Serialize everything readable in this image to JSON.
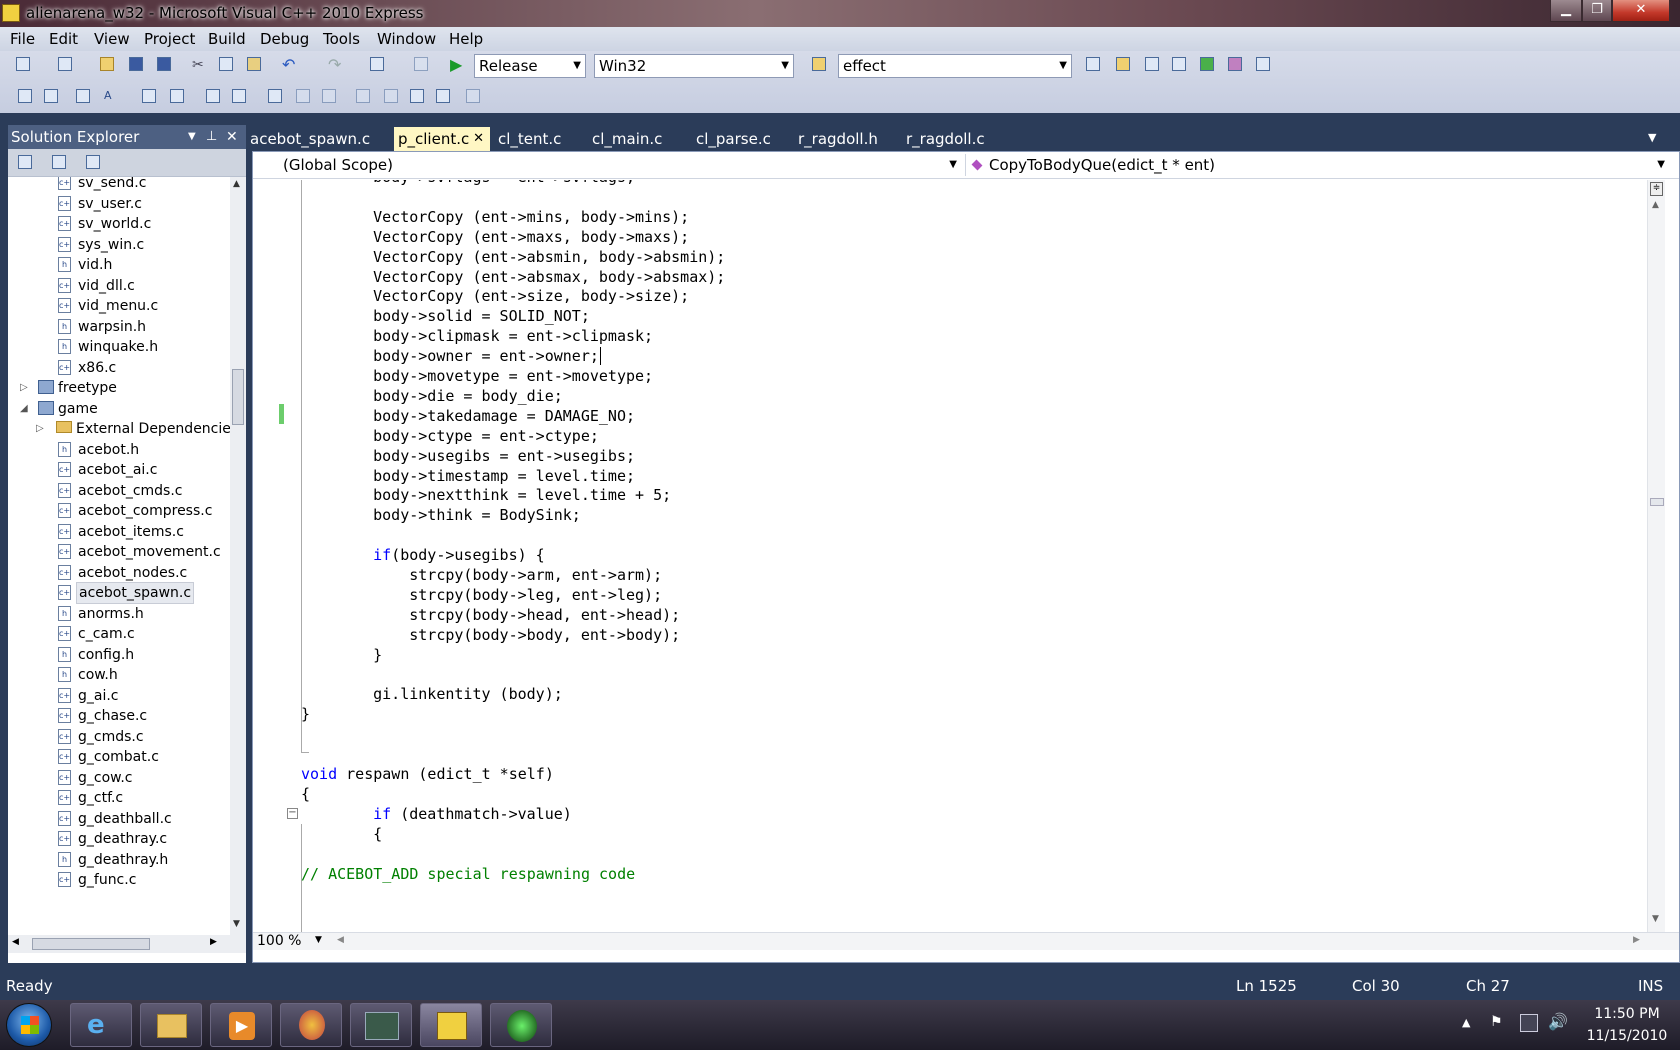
{
  "window": {
    "title": "alienarena_w32 - Microsoft Visual C++ 2010 Express"
  },
  "menu": [
    "File",
    "Edit",
    "View",
    "Project",
    "Build",
    "Debug",
    "Tools",
    "Window",
    "Help"
  ],
  "toolbar": {
    "config": "Release",
    "platform": "Win32",
    "find": "effect"
  },
  "solution_explorer": {
    "title": "Solution Explorer",
    "items": [
      {
        "label": "sv_send.c",
        "type": "c"
      },
      {
        "label": "sv_user.c",
        "type": "c"
      },
      {
        "label": "sv_world.c",
        "type": "c"
      },
      {
        "label": "sys_win.c",
        "type": "c"
      },
      {
        "label": "vid.h",
        "type": "h"
      },
      {
        "label": "vid_dll.c",
        "type": "c"
      },
      {
        "label": "vid_menu.c",
        "type": "c"
      },
      {
        "label": "warpsin.h",
        "type": "h"
      },
      {
        "label": "winquake.h",
        "type": "h"
      },
      {
        "label": "x86.c",
        "type": "c"
      },
      {
        "label": "freetype",
        "type": "project"
      },
      {
        "label": "game",
        "type": "project"
      },
      {
        "label": "External Dependencie",
        "type": "folder"
      },
      {
        "label": "acebot.h",
        "type": "h"
      },
      {
        "label": "acebot_ai.c",
        "type": "c"
      },
      {
        "label": "acebot_cmds.c",
        "type": "c"
      },
      {
        "label": "acebot_compress.c",
        "type": "c"
      },
      {
        "label": "acebot_items.c",
        "type": "c"
      },
      {
        "label": "acebot_movement.c",
        "type": "c"
      },
      {
        "label": "acebot_nodes.c",
        "type": "c"
      },
      {
        "label": "acebot_spawn.c",
        "type": "c"
      },
      {
        "label": "anorms.h",
        "type": "h"
      },
      {
        "label": "c_cam.c",
        "type": "c"
      },
      {
        "label": "config.h",
        "type": "h"
      },
      {
        "label": "cow.h",
        "type": "h"
      },
      {
        "label": "g_ai.c",
        "type": "c"
      },
      {
        "label": "g_chase.c",
        "type": "c"
      },
      {
        "label": "g_cmds.c",
        "type": "c"
      },
      {
        "label": "g_combat.c",
        "type": "c"
      },
      {
        "label": "g_cow.c",
        "type": "c"
      },
      {
        "label": "g_ctf.c",
        "type": "c"
      },
      {
        "label": "g_deathball.c",
        "type": "c"
      },
      {
        "label": "g_deathray.c",
        "type": "c"
      },
      {
        "label": "g_deathray.h",
        "type": "h"
      },
      {
        "label": "g_func.c",
        "type": "c"
      }
    ]
  },
  "tabs": [
    "acebot_spawn.c",
    "p_client.c",
    "cl_tent.c",
    "cl_main.c",
    "cl_parse.c",
    "r_ragdoll.h",
    "r_ragdoll.c"
  ],
  "active_tab": "p_client.c",
  "nav": {
    "scope": "(Global Scope)",
    "member": "CopyToBodyQue(edict_t * ent)"
  },
  "code": [
    "    body->svflags = ent->svflags;",
    "",
    "    VectorCopy (ent->mins, body->mins);",
    "    VectorCopy (ent->maxs, body->maxs);",
    "    VectorCopy (ent->absmin, body->absmin);",
    "    VectorCopy (ent->absmax, body->absmax);",
    "    VectorCopy (ent->size, body->size);",
    "    body->solid = SOLID_NOT;",
    "    body->clipmask = ent->clipmask;",
    "    body->owner = ent->owner;",
    "    body->movetype = ent->movetype;",
    "    body->die = body_die;",
    "    body->takedamage = DAMAGE_NO;",
    "    body->ctype = ent->ctype;",
    "    body->usegibs = ent->usegibs;",
    "    body->timestamp = level.time;",
    "    body->nextthink = level.time + 5;",
    "    body->think = BodySink;",
    "",
    "    if(body->usegibs) {",
    "        strcpy(body->arm, ent->arm);",
    "        strcpy(body->leg, ent->leg);",
    "        strcpy(body->head, ent->head);",
    "        strcpy(body->body, ent->body);",
    "    }",
    "",
    "    gi.linkentity (body);",
    "}",
    "",
    "",
    "void respawn (edict_t *self)",
    "{",
    "    if (deathmatch->value)",
    "    {",
    "",
    "// ACEBOT_ADD special respawning code"
  ],
  "zoom": "100 %",
  "status": {
    "ready": "Ready",
    "ln": "Ln 1525",
    "col": "Col 30",
    "ch": "Ch 27",
    "ins": "INS"
  },
  "clock": {
    "time": "11:50 PM",
    "date": "11/15/2010"
  }
}
